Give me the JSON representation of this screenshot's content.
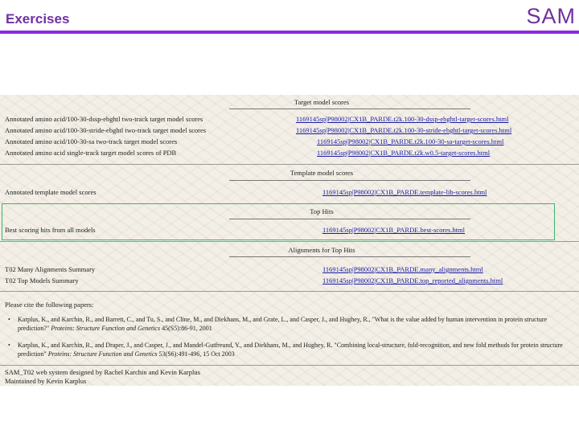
{
  "slide": {
    "title": "Exercises",
    "brand": "SAM"
  },
  "colors": {
    "accent": "#7030a0",
    "highlight_box": "#3cb371",
    "link": "#1a1aa6"
  },
  "webpage": {
    "sections": [
      {
        "heading": "Target model scores",
        "rows": [
          {
            "label": "Annotated amino acid/100-30-dssp-ebghtl two-track target model scores",
            "link": "1169145sp|P98002|CX1B_PARDE.t2k.100-30-dssp-ebghtl-target-scores.html"
          },
          {
            "label": "Annotated amino acid/100-30-stride-ebghtl two-track target model scores",
            "link": "1169145sp|P98002|CX1B_PARDE.t2k.100-30-stride-ebghtl-target-scores.html"
          },
          {
            "label": "Annotated amino acid/100-30-sa two-track target model scores",
            "link": "1169145sp|P98002|CX1B_PARDE.t2k.100-30-sa-target-scores.html"
          },
          {
            "label": "Annotated amino acid single-track target model scores of PDB",
            "link": "1169145sp|P98002|CX1B_PARDE.t2k.w0.5-target-scores.html"
          }
        ]
      },
      {
        "heading": "Template model scores",
        "rows": [
          {
            "label": "Annotated template model scores",
            "link": "1169145sp|P98002|CX1B_PARDE.template-lib-scores.html"
          }
        ]
      },
      {
        "heading": "Top Hits",
        "rows": [
          {
            "label": "Best scoring hits from all models",
            "link": "1169145sp|P98002|CX1B_PARDE.best-scores.html"
          }
        ]
      },
      {
        "heading": "Alignments for Top Hits",
        "rows": [
          {
            "label": "T02 Many Alignments Summary",
            "link": "1169145sp|P98002|CX1B_PARDE.many_alignments.html"
          },
          {
            "label": "T02 Top Models Summary",
            "link": "1169145sp|P98002|CX1B_PARDE.top_reported_alignments.html"
          }
        ]
      }
    ],
    "cite_intro": "Please cite the following papers:",
    "citations": [
      {
        "text": "Karplus, K., and Karchin, R., and Barrett, C., and Tu, S., and Cline, M., and Diekhans, M., and Grate, L., and Casper, J., and Hughey, R., \"What is the value added by human intervention in protein structure prediction?\"",
        "journal": "Proteins: Structure Function and Genetics",
        "tail": "45(S5):86-91, 2001"
      },
      {
        "text": "Karplus, K., and Karchin, R., and Draper, J., and Casper, J., and Mandel-Gutfreund, Y., and Diekhans, M., and Hughey, R. \"Combining local-structure, fold-recognition, and new fold methods for protein structure prediction\"",
        "journal": "Proteins: Structure Function and Genetics",
        "tail": "53(S6):491-496, 15 Oct 2003"
      }
    ],
    "footer_lines": [
      "SAM_T02 web system designed by Rachel Karchin and Kevin Karplus",
      "Maintained by Kevin Karplus"
    ]
  }
}
